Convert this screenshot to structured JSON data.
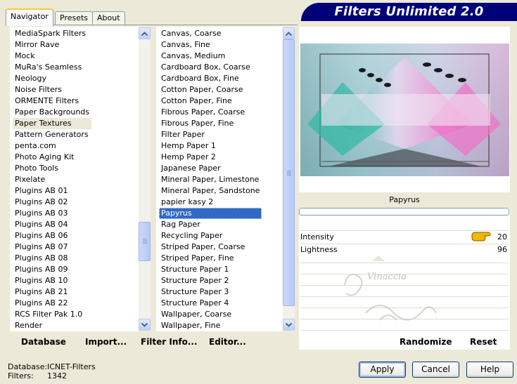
{
  "tabs": [
    "Navigator",
    "Presets",
    "About"
  ],
  "banner_title": "Filters Unlimited 2.0",
  "categories": [
    "MediaSpark Filters",
    "Mirror Rave",
    "Mock",
    "MuRa's Seamless",
    "Neology",
    "Noise Filters",
    "ORMENTE Filters",
    "Paper Backgrounds",
    "Paper Textures",
    "Pattern Generators",
    "penta.com",
    "Photo Aging Kit",
    "Photo Tools",
    "Pixelate",
    "Plugins AB 01",
    "Plugins AB 02",
    "Plugins AB 03",
    "Plugins AB 04",
    "Plugins AB 06",
    "Plugins AB 07",
    "Plugins AB 08",
    "Plugins AB 09",
    "Plugins AB 10",
    "Plugins AB 21",
    "Plugins AB 22",
    "RCS Filter Pak 1.0",
    "Render"
  ],
  "selected_category": "Paper Textures",
  "filters": [
    "Canvas, Coarse",
    "Canvas, Fine",
    "Canvas, Medium",
    "Cardboard Box, Coarse",
    "Cardboard Box, Fine",
    "Cotton Paper, Coarse",
    "Cotton Paper, Fine",
    "Fibrous Paper, Coarse",
    "Fibrous Paper, Fine",
    "Filter Paper",
    "Hemp Paper 1",
    "Hemp Paper 2",
    "Japanese Paper",
    "Mineral Paper, Limestone",
    "Mineral Paper, Sandstone",
    "papier kasy 2",
    "Papyrus",
    "Rag Paper",
    "Recycling Paper",
    "Striped Paper, Coarse",
    "Striped Paper, Fine",
    "Structure Paper 1",
    "Structure Paper 2",
    "Structure Paper 3",
    "Structure Paper 4",
    "Wallpaper, Coarse",
    "Wallpaper, Fine"
  ],
  "selected_filter": "Papyrus",
  "toolbar": {
    "database": "Database",
    "import": "Import...",
    "filter_info": "Filter Info...",
    "editor": "Editor..."
  },
  "preview": {
    "filter_name": "Papyrus",
    "progress": 0
  },
  "parameters": [
    {
      "label": "Intensity",
      "value": "20"
    },
    {
      "label": "Lightness",
      "value": "96"
    }
  ],
  "randomize_label": "Randomize",
  "reset_label": "Reset",
  "status": {
    "database_label": "Database:",
    "database_value": "ICNET-Filters",
    "filters_label": "Filters:",
    "filters_value": "1342"
  },
  "buttons": {
    "apply": "Apply",
    "cancel": "Cancel",
    "help": "Help"
  },
  "watermark_text": "Vinaccia",
  "colors": {
    "banner": "#00007b",
    "selection_blue": "#316ac5",
    "pointer_hand": "#f0b800"
  }
}
